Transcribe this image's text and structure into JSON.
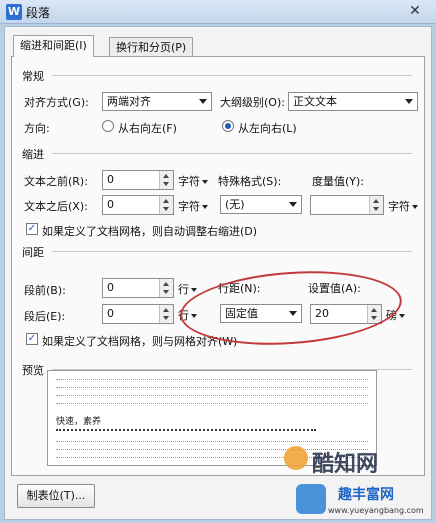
{
  "window": {
    "title": "段落",
    "app_icon": "W",
    "close_glyph": "✕"
  },
  "tabs": [
    {
      "label": "缩进和间距(I)",
      "active": true
    },
    {
      "label": "换行和分页(P)",
      "active": false
    }
  ],
  "general": {
    "section": "常规",
    "alignment_label": "对齐方式(G):",
    "alignment_value": "两端对齐",
    "outline_label": "大纲级别(O):",
    "outline_value": "正文文本",
    "direction_label": "方向:",
    "rtl_label": "从右向左(F)",
    "ltr_label": "从左向右(L)"
  },
  "indent": {
    "section": "缩进",
    "before_label": "文本之前(R):",
    "before_value": "0",
    "before_unit": "字符",
    "after_label": "文本之后(X):",
    "after_value": "0",
    "after_unit": "字符",
    "special_label": "特殊格式(S):",
    "special_value": "(无)",
    "measure_label": "度量值(Y):",
    "measure_value": "",
    "measure_unit": "字符",
    "auto_adjust_label": "如果定义了文档网格，则自动调整右缩进(D)",
    "auto_adjust_checked": true
  },
  "spacing": {
    "section": "间距",
    "before_label": "段前(B):",
    "before_value": "0",
    "before_unit": "行",
    "after_label": "段后(E):",
    "after_value": "0",
    "after_unit": "行",
    "line_label": "行距(N):",
    "line_value": "固定值",
    "setting_label": "设置值(A):",
    "setting_value": "20",
    "setting_unit": "磅",
    "snap_grid_label": "如果定义了文档网格，则与网格对齐(W)",
    "snap_grid_checked": true
  },
  "preview": {
    "section": "预览",
    "sample_text": "快速，素养"
  },
  "footer": {
    "tabs_button": "制表位(T)..."
  },
  "watermark": {
    "brand": "酷知网",
    "brand2": "趣丰富网",
    "url": "www.yueyangbang.com"
  },
  "colors": {
    "annotation_ellipse": "#c23a3a",
    "radio_fill": "#1d5fbf"
  }
}
